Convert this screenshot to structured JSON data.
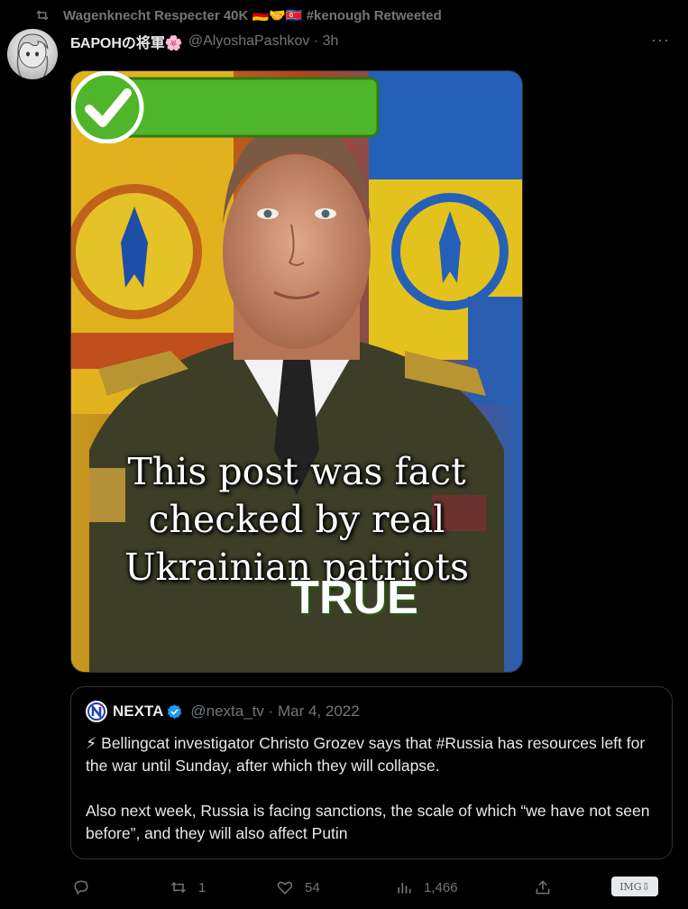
{
  "retweet_bar": {
    "text": "Wagenknecht Respecter 40K 🇩🇪🤝🇰🇵 #kenough Retweeted"
  },
  "tweet": {
    "display_name": "БАРОНの将軍🌸",
    "handle_time": "@AlyoshaPashkov · 3h",
    "more_label": "···"
  },
  "media": {
    "overlay_lines": [
      "This post was fact",
      "checked by real",
      "Ukrainian patriots"
    ],
    "badge_text": "TRUE"
  },
  "quote": {
    "name": "NEXTA",
    "meta": "@nexta_tv · Mar 4, 2022",
    "paragraph1": "⚡ Bellingcat investigator Christo Grozev says that #Russia has resources left for the war until Sunday, after which they will collapse.",
    "paragraph2": "Also next week, Russia is facing sanctions, the scale of which “we have not seen before”, and they will also affect Putin"
  },
  "actions": {
    "replies": "",
    "retweets": "1",
    "likes": "54",
    "views": "1,466",
    "img_label": "IMG⇩"
  },
  "icons": [
    "retweet-icon",
    "more-icon",
    "verified-icon",
    "reply-icon",
    "like-icon",
    "views-icon",
    "share-icon"
  ],
  "colors": {
    "background": "#000000",
    "text": "#e7e9ea",
    "muted": "#71767b",
    "verified": "#1d9bf0",
    "true_green": "#4fb52a"
  }
}
